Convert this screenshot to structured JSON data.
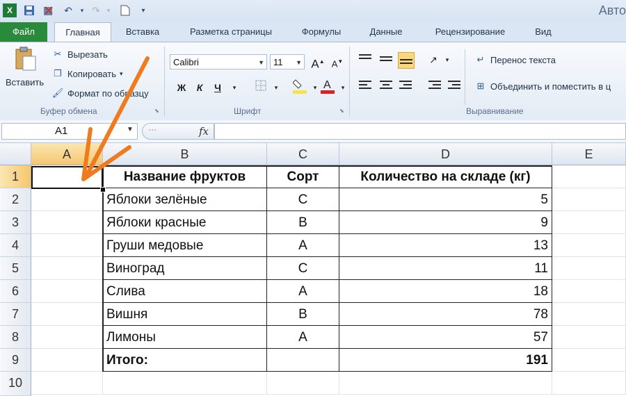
{
  "titlebar": {
    "app_title": "Авто",
    "icons": [
      "excel-logo-icon",
      "save-icon",
      "undo-with-disk-icon",
      "undo-icon",
      "redo-icon",
      "new-document-icon",
      "customize-qat-icon"
    ]
  },
  "tabs": {
    "file": "Файл",
    "items": [
      "Главная",
      "Вставка",
      "Разметка страницы",
      "Формулы",
      "Данные",
      "Рецензирование",
      "Вид"
    ]
  },
  "ribbon": {
    "clipboard": {
      "paste": "Вставить",
      "cut": "Вырезать",
      "copy": "Копировать",
      "format_painter": "Формат по образцу",
      "label": "Буфер обмена"
    },
    "font": {
      "name": "Calibri",
      "size": "11",
      "grow": "A",
      "shrink": "A",
      "bold": "Ж",
      "italic": "К",
      "underline": "Ч",
      "label": "Шрифт",
      "fill_color": "#f5e14a",
      "font_color": "#e02020"
    },
    "alignment": {
      "wrap": "Перенос текста",
      "merge": "Объединить и поместить в ц",
      "label": "Выравнивание"
    }
  },
  "formula_bar": {
    "name_box": "A1",
    "fx": "fx",
    "value": ""
  },
  "sheet": {
    "columns": [
      "A",
      "B",
      "C",
      "D",
      "E"
    ],
    "rows": [
      "1",
      "2",
      "3",
      "4",
      "5",
      "6",
      "7",
      "8",
      "9",
      "10"
    ],
    "header": {
      "name": "Название фруктов",
      "sort": "Сорт",
      "qty": "Количество на складе (кг)"
    },
    "data": [
      {
        "name": "Яблоки зелёные",
        "sort": "С",
        "qty": "5"
      },
      {
        "name": "Яблоки красные",
        "sort": "В",
        "qty": "9"
      },
      {
        "name": "Груши медовые",
        "sort": "А",
        "qty": "13"
      },
      {
        "name": "Виноград",
        "sort": "С",
        "qty": "11"
      },
      {
        "name": "Слива",
        "sort": "А",
        "qty": "18"
      },
      {
        "name": "Вишня",
        "sort": "В",
        "qty": "78"
      },
      {
        "name": "Лимоны",
        "sort": "А",
        "qty": "57"
      }
    ],
    "total": {
      "label": "Итого:",
      "sort": "",
      "qty": "191"
    }
  },
  "colors": {
    "accent": "#2a8a3c",
    "arrow": "#f07a1e",
    "selected_header": "#f5c66d"
  }
}
